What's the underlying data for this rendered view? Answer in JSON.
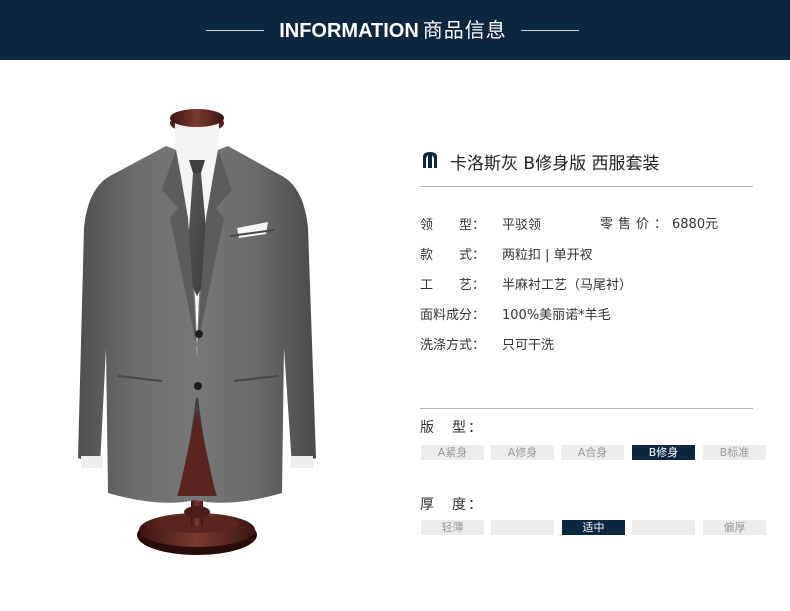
{
  "header": {
    "title_en": "INFORMATION",
    "title_cn": "商品信息"
  },
  "product": {
    "brand_icon": "brand-logo-icon",
    "title": "卡洛斯灰 B修身版 西服套装"
  },
  "specs": [
    {
      "label": "领　　型",
      "value": "平驳领"
    },
    {
      "label": "款　　式",
      "value": "两粒扣 | 单开衩"
    },
    {
      "label": "工　　艺",
      "value": "半麻衬工艺（马尾衬）"
    },
    {
      "label": "面料成分",
      "value": "100%美丽诺*羊毛"
    },
    {
      "label": "洗涤方式",
      "value": "只可干洗"
    }
  ],
  "price": {
    "label": "零售价：",
    "value": "6880元"
  },
  "fit": {
    "label": "版　型：",
    "options": [
      "A紧身",
      "A修身",
      "A合身",
      "B修身",
      "B标准"
    ],
    "selected": "B修身"
  },
  "thickness": {
    "label": "厚　度：",
    "options": [
      "轻薄",
      "",
      "适中",
      "",
      "偏厚"
    ],
    "selected": "适中"
  },
  "colors": {
    "header_bg": "#0d2740",
    "accent": "#0d2740",
    "option_bg": "#ececec"
  }
}
